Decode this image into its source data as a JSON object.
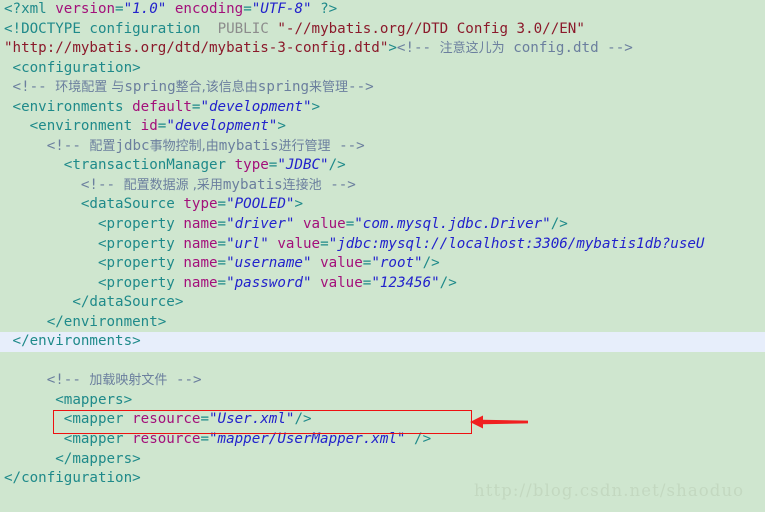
{
  "editor": {
    "background_color": "#cfe6cf",
    "highlight_line_color": "#e7eefb",
    "font_size_px": 14,
    "colors": {
      "tag": "#1f8a8a",
      "attribute_name": "#a3107a",
      "attribute_value": "#2222cc",
      "comment": "#6b7f9e",
      "keyword": "#8c8c8c",
      "doctype_string": "#8b1a2b",
      "annotation_red": "#ee1111",
      "watermark": "#c3d8c0"
    }
  },
  "code": {
    "language": "xml",
    "file_kind": "mybatis-config",
    "lines": [
      {
        "index": 1,
        "highlighted": false,
        "text": "<?xml version=\"1.0\" encoding=\"UTF-8\" ?>",
        "tokens": [
          {
            "t": "<?xml ",
            "c": "tag"
          },
          {
            "t": "version",
            "c": "attr"
          },
          {
            "t": "=",
            "c": "plain"
          },
          {
            "t": "\"1.0\"",
            "c": "str"
          },
          {
            "t": " ",
            "c": "plain"
          },
          {
            "t": "encoding",
            "c": "attr"
          },
          {
            "t": "=",
            "c": "plain"
          },
          {
            "t": "\"UTF-8\"",
            "c": "str"
          },
          {
            "t": " ?>",
            "c": "tag"
          }
        ]
      },
      {
        "index": 2,
        "highlighted": false,
        "text": "<!DOCTYPE configuration  PUBLIC \"-//mybatis.org//DTD Config 3.0//EN\"",
        "tokens": [
          {
            "t": "<!DOCTYPE configuration",
            "c": "tag"
          },
          {
            "t": "  ",
            "c": "plain"
          },
          {
            "t": "PUBLIC",
            "c": "kw"
          },
          {
            "t": " ",
            "c": "plain"
          },
          {
            "t": "\"-//mybatis.org//DTD Config 3.0//EN\"",
            "c": "dstr"
          }
        ]
      },
      {
        "index": 3,
        "highlighted": false,
        "text": "\"http://mybatis.org/dtd/mybatis-3-config.dtd\"><!-- 注意这儿为 config.dtd -->",
        "tokens": [
          {
            "t": "\"http://mybatis.org/dtd/mybatis-3-config.dtd\"",
            "c": "dstr"
          },
          {
            "t": ">",
            "c": "tag"
          },
          {
            "t": "<!-- ",
            "c": "cmt"
          },
          {
            "t": "注意这儿为",
            "c": "cmt cn"
          },
          {
            "t": " config.dtd -->",
            "c": "cmt"
          }
        ]
      },
      {
        "index": 4,
        "highlighted": false,
        "text": " <configuration>",
        "tokens": [
          {
            "t": " <configuration>",
            "c": "tag"
          }
        ]
      },
      {
        "index": 5,
        "highlighted": false,
        "text": " <!-- 环境配置 与spring整合,该信息由spring来管理-->",
        "tokens": [
          {
            "t": " <!-- ",
            "c": "cmt"
          },
          {
            "t": "环境配置 与",
            "c": "cmt cn"
          },
          {
            "t": "spring",
            "c": "cmt"
          },
          {
            "t": "整合,该信息由",
            "c": "cmt cn"
          },
          {
            "t": "spring",
            "c": "cmt"
          },
          {
            "t": "来管理",
            "c": "cmt cn"
          },
          {
            "t": "-->",
            "c": "cmt"
          }
        ]
      },
      {
        "index": 6,
        "highlighted": false,
        "text": " <environments default=\"development\">",
        "tokens": [
          {
            "t": " <environments ",
            "c": "tag"
          },
          {
            "t": "default",
            "c": "attr"
          },
          {
            "t": "=",
            "c": "plain"
          },
          {
            "t": "\"development\"",
            "c": "str"
          },
          {
            "t": ">",
            "c": "tag"
          }
        ]
      },
      {
        "index": 7,
        "highlighted": false,
        "text": "   <environment id=\"development\">",
        "tokens": [
          {
            "t": "   <environment ",
            "c": "tag"
          },
          {
            "t": "id",
            "c": "attr"
          },
          {
            "t": "=",
            "c": "plain"
          },
          {
            "t": "\"development\"",
            "c": "str"
          },
          {
            "t": ">",
            "c": "tag"
          }
        ]
      },
      {
        "index": 8,
        "highlighted": false,
        "text": "     <!-- 配置jdbc事物控制,由mybatis进行管理 -->",
        "tokens": [
          {
            "t": "     <!-- ",
            "c": "cmt"
          },
          {
            "t": "配置",
            "c": "cmt cn"
          },
          {
            "t": "jdbc",
            "c": "cmt"
          },
          {
            "t": "事物控制,由",
            "c": "cmt cn"
          },
          {
            "t": "mybatis",
            "c": "cmt"
          },
          {
            "t": "进行管理",
            "c": "cmt cn"
          },
          {
            "t": " -->",
            "c": "cmt"
          }
        ]
      },
      {
        "index": 9,
        "highlighted": false,
        "text": "       <transactionManager type=\"JDBC\"/>",
        "tokens": [
          {
            "t": "       <transactionManager ",
            "c": "tag"
          },
          {
            "t": "type",
            "c": "attr"
          },
          {
            "t": "=",
            "c": "plain"
          },
          {
            "t": "\"JDBC\"",
            "c": "str"
          },
          {
            "t": "/>",
            "c": "tag"
          }
        ]
      },
      {
        "index": 10,
        "highlighted": false,
        "text": "         <!-- 配置数据源 ,采用mybatis连接池 -->",
        "tokens": [
          {
            "t": "         <!-- ",
            "c": "cmt"
          },
          {
            "t": "配置数据源 ,采用",
            "c": "cmt cn"
          },
          {
            "t": "mybatis",
            "c": "cmt"
          },
          {
            "t": "连接池",
            "c": "cmt cn"
          },
          {
            "t": " -->",
            "c": "cmt"
          }
        ]
      },
      {
        "index": 11,
        "highlighted": false,
        "text": "         <dataSource type=\"POOLED\">",
        "tokens": [
          {
            "t": "         <dataSource ",
            "c": "tag"
          },
          {
            "t": "type",
            "c": "attr"
          },
          {
            "t": "=",
            "c": "plain"
          },
          {
            "t": "\"POOLED\"",
            "c": "str"
          },
          {
            "t": ">",
            "c": "tag"
          }
        ]
      },
      {
        "index": 12,
        "highlighted": false,
        "text": "           <property name=\"driver\" value=\"com.mysql.jdbc.Driver\"/>",
        "tokens": [
          {
            "t": "           <property ",
            "c": "tag"
          },
          {
            "t": "name",
            "c": "attr"
          },
          {
            "t": "=",
            "c": "plain"
          },
          {
            "t": "\"driver\"",
            "c": "str"
          },
          {
            "t": " ",
            "c": "plain"
          },
          {
            "t": "value",
            "c": "attr"
          },
          {
            "t": "=",
            "c": "plain"
          },
          {
            "t": "\"com.mysql.jdbc.Driver\"",
            "c": "str"
          },
          {
            "t": "/>",
            "c": "tag"
          }
        ]
      },
      {
        "index": 13,
        "highlighted": false,
        "text": "           <property name=\"url\" value=\"jdbc:mysql://localhost:3306/mybatis1db?useU",
        "clipped_at_right_edge": true,
        "tokens": [
          {
            "t": "           <property ",
            "c": "tag"
          },
          {
            "t": "name",
            "c": "attr"
          },
          {
            "t": "=",
            "c": "plain"
          },
          {
            "t": "\"url\"",
            "c": "str"
          },
          {
            "t": " ",
            "c": "plain"
          },
          {
            "t": "value",
            "c": "attr"
          },
          {
            "t": "=",
            "c": "plain"
          },
          {
            "t": "\"jdbc:mysql://localhost:3306/mybatis1db?useU",
            "c": "str"
          }
        ]
      },
      {
        "index": 14,
        "highlighted": false,
        "text": "           <property name=\"username\" value=\"root\"/>",
        "tokens": [
          {
            "t": "           <property ",
            "c": "tag"
          },
          {
            "t": "name",
            "c": "attr"
          },
          {
            "t": "=",
            "c": "plain"
          },
          {
            "t": "\"username\"",
            "c": "str"
          },
          {
            "t": " ",
            "c": "plain"
          },
          {
            "t": "value",
            "c": "attr"
          },
          {
            "t": "=",
            "c": "plain"
          },
          {
            "t": "\"root\"",
            "c": "str"
          },
          {
            "t": "/>",
            "c": "tag"
          }
        ]
      },
      {
        "index": 15,
        "highlighted": false,
        "text": "           <property name=\"password\" value=\"123456\"/>",
        "tokens": [
          {
            "t": "           <property ",
            "c": "tag"
          },
          {
            "t": "name",
            "c": "attr"
          },
          {
            "t": "=",
            "c": "plain"
          },
          {
            "t": "\"password\"",
            "c": "str"
          },
          {
            "t": " ",
            "c": "plain"
          },
          {
            "t": "value",
            "c": "attr"
          },
          {
            "t": "=",
            "c": "plain"
          },
          {
            "t": "\"123456\"",
            "c": "str"
          },
          {
            "t": "/>",
            "c": "tag"
          }
        ]
      },
      {
        "index": 16,
        "highlighted": false,
        "text": "        </dataSource>",
        "tokens": [
          {
            "t": "        </dataSource>",
            "c": "tag"
          }
        ]
      },
      {
        "index": 17,
        "highlighted": false,
        "text": "     </environment>",
        "tokens": [
          {
            "t": "     </environment>",
            "c": "tag"
          }
        ]
      },
      {
        "index": 18,
        "highlighted": true,
        "text": " </environments>",
        "tokens": [
          {
            "t": " </environments>",
            "c": "tag"
          }
        ]
      },
      {
        "index": 19,
        "highlighted": false,
        "text": "",
        "tokens": []
      },
      {
        "index": 20,
        "highlighted": false,
        "text": "     <!-- 加载映射文件 -->",
        "tokens": [
          {
            "t": "     <!-- ",
            "c": "cmt"
          },
          {
            "t": "加载映射文件",
            "c": "cmt cn"
          },
          {
            "t": " -->",
            "c": "cmt"
          }
        ]
      },
      {
        "index": 21,
        "highlighted": false,
        "text": "      <mappers>",
        "tokens": [
          {
            "t": "      <mappers>",
            "c": "tag"
          }
        ]
      },
      {
        "index": 22,
        "highlighted": false,
        "text": "       <mapper resource=\"User.xml\"/>",
        "tokens": [
          {
            "t": "       <mapper ",
            "c": "tag"
          },
          {
            "t": "resource",
            "c": "attr"
          },
          {
            "t": "=",
            "c": "plain"
          },
          {
            "t": "\"User.xml\"",
            "c": "str"
          },
          {
            "t": "/>",
            "c": "tag"
          }
        ]
      },
      {
        "index": 23,
        "highlighted": false,
        "annotated": true,
        "text": "       <mapper resource=\"mapper/UserMapper.xml\" />",
        "tokens": [
          {
            "t": "       <mapper ",
            "c": "tag"
          },
          {
            "t": "resource",
            "c": "attr"
          },
          {
            "t": "=",
            "c": "plain"
          },
          {
            "t": "\"mapper/UserMapper.xml\"",
            "c": "str"
          },
          {
            "t": " />",
            "c": "tag"
          }
        ]
      },
      {
        "index": 24,
        "highlighted": false,
        "text": "      </mappers>",
        "tokens": [
          {
            "t": "      </mappers>",
            "c": "tag"
          }
        ]
      },
      {
        "index": 25,
        "highlighted": false,
        "text": "</configuration>",
        "tokens": [
          {
            "t": "</configuration>",
            "c": "tag"
          }
        ]
      }
    ]
  },
  "annotation": {
    "kind": "red-rectangle-with-arrow",
    "target_line_index": 23,
    "color": "#ee1111",
    "arrow_direction": "left"
  },
  "watermark": {
    "text": "http://blog.csdn.net/shaoduo"
  }
}
